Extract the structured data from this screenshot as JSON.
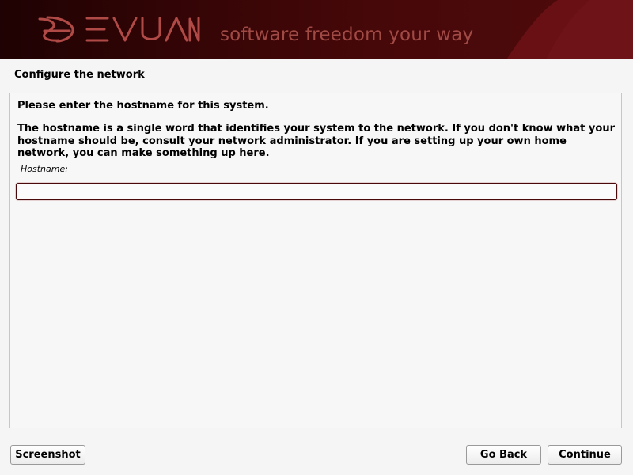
{
  "banner": {
    "logo_text": "DEVUAN",
    "tagline": "software freedom your way"
  },
  "page": {
    "title": "Configure the network"
  },
  "dialog": {
    "question": "Please enter the hostname for this system.",
    "description": "The hostname is a single word that identifies your system to the network. If you don't know what your hostname should be, consult your network administrator. If you are setting up your own home network, you can make something up here.",
    "hostname_label": "Hostname:",
    "hostname_value": ""
  },
  "buttons": {
    "screenshot": "Screenshot",
    "go_back": "Go Back",
    "continue": "Continue"
  },
  "colors": {
    "banner_dark": "#1f0203",
    "banner_red": "#6b0f12",
    "logo": "#b04a47",
    "tagline": "#a04a45",
    "input_border": "#4a0a0c"
  }
}
